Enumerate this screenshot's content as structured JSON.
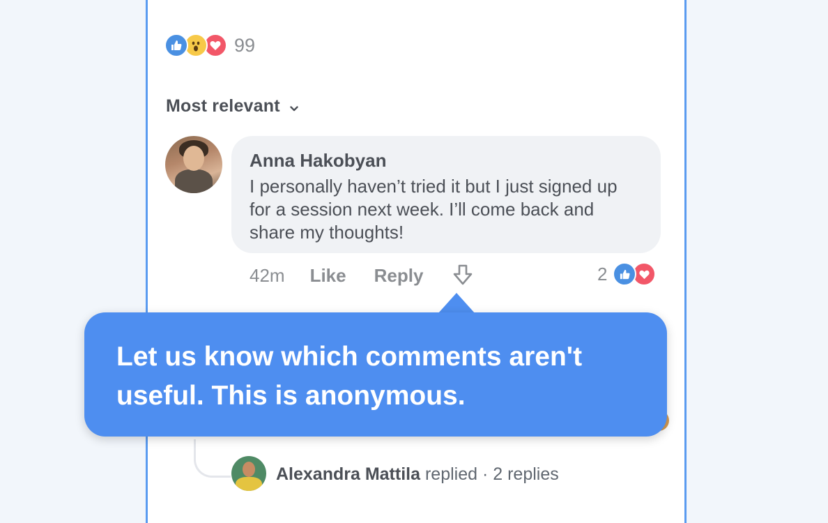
{
  "post": {
    "reaction_count": "99",
    "reaction_icons": [
      "thumbs-up-icon",
      "wow-face-icon",
      "heart-icon"
    ]
  },
  "comments": {
    "sort_label": "Most relevant",
    "items": [
      {
        "author": "Anna Hakobyan",
        "text": "I personally haven’t tried it but I just signed up for a session next week. I’ll come back and share my thoughts!",
        "time": "42m",
        "like_label": "Like",
        "reply_label": "Reply",
        "reaction_count": "2",
        "reaction_icons": [
          "thumbs-up-icon",
          "heart-icon"
        ]
      }
    ],
    "reply_summary": {
      "author": "Alexandra Mattila",
      "text": "replied · 2 replies"
    }
  },
  "tooltip": {
    "message": "Let us know which comments aren't useful. This is anonymous."
  },
  "colors": {
    "accent": "#4e8ef0",
    "like": "#4a90e2",
    "love": "#f25768",
    "wow": "#f7c948",
    "text": "#4b4f56",
    "muted": "#8a8d91"
  }
}
